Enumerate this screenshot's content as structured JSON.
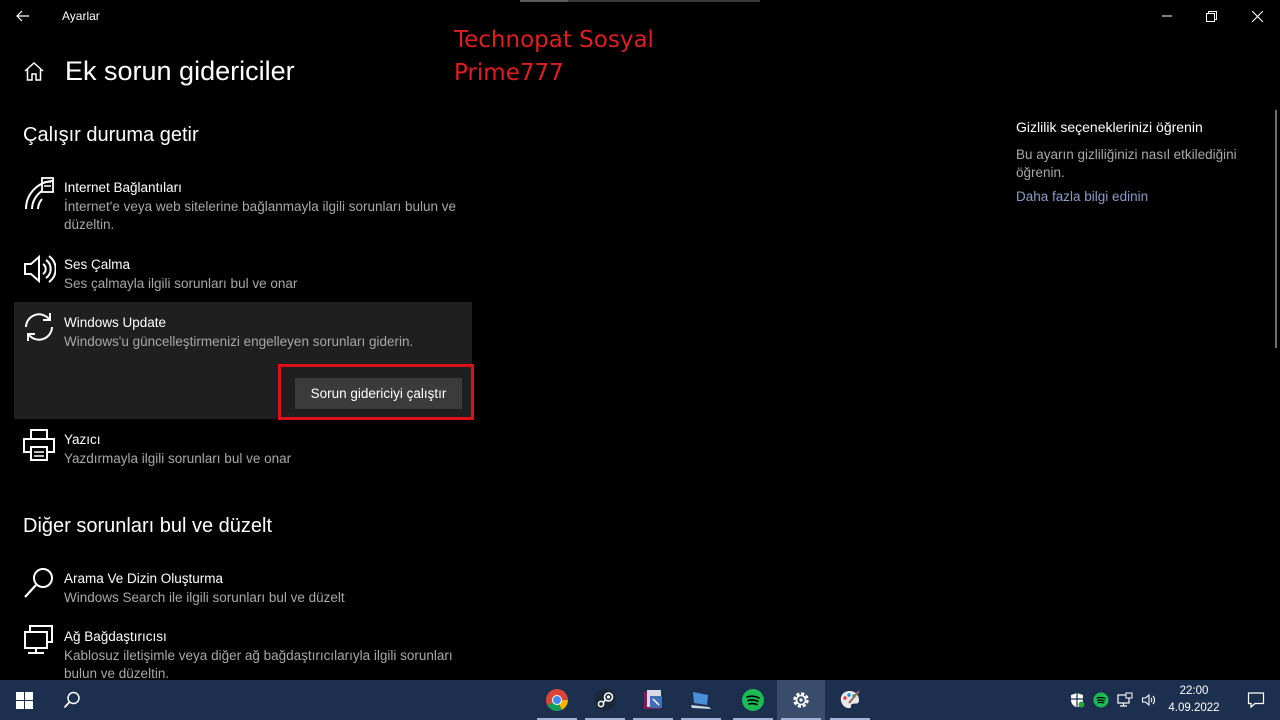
{
  "window": {
    "title": "Ayarlar",
    "back_icon": "arrow-left-icon",
    "controls": [
      "minimize-icon",
      "restore-icon",
      "close-icon"
    ]
  },
  "watermark": {
    "line1": "Technopat Sosyal",
    "line2": "Prime777",
    "color": "#e01e22"
  },
  "page": {
    "title": "Ek sorun gidericiler"
  },
  "sections": {
    "get_running": {
      "title": "Çalışır duruma getir",
      "items": [
        {
          "name": "Internet Bağlantıları",
          "description": "İnternet'e veya web sitelerine bağlanmayla ilgili sorunları bulun ve düzeltin.",
          "icon": "wifi-icon"
        },
        {
          "name": "Ses Çalma",
          "description": "Ses çalmayla ilgili sorunları bul ve onar",
          "icon": "speaker-icon"
        },
        {
          "name": "Windows Update",
          "description": "Windows'u güncelleştirmenizi engelleyen sorunları giderin.",
          "icon": "sync-icon",
          "button": "Sorun gidericiyi çalıştır"
        },
        {
          "name": "Yazıcı",
          "description": "Yazdırmayla ilgili sorunları bul ve onar",
          "icon": "printer-icon"
        }
      ]
    },
    "other": {
      "title": "Diğer sorunları bul ve düzelt",
      "items": [
        {
          "name": "Arama Ve Dizin Oluşturma",
          "description": "Windows Search ile ilgili sorunları bul ve düzelt",
          "icon": "search-icon"
        },
        {
          "name": "Ağ Bağdaştırıcısı",
          "description": "Kablosuz iletişimle veya diğer ağ bağdaştırıcılarıyla ilgili sorunları bulun ve düzeltin.",
          "icon": "network-adapter-icon"
        }
      ]
    }
  },
  "privacy": {
    "title": "Gizlilik seçeneklerinizi öğrenin",
    "text": "Bu ayarın gizliliğinizi nasıl etkilediğini öğrenin.",
    "link": "Daha fazla bilgi edinin"
  },
  "taskbar": {
    "apps": [
      "chrome-icon",
      "steam-icon",
      "file-archiver-icon",
      "laptop-app-icon",
      "spotify-icon",
      "settings-gear-icon",
      "paint-icon"
    ],
    "active_app": "settings-gear-icon",
    "tray": [
      "security-shield-icon",
      "spotify-tray-icon",
      "network-icon",
      "volume-icon"
    ],
    "time": "22:00",
    "date": "4.09.2022",
    "colors": {
      "background": "#1d2f4f",
      "active": "#3a4c6b"
    }
  },
  "colors": {
    "highlight_border": "#e0101a",
    "link": "#8a9bc4",
    "secondary_text": "#a8a8a8"
  }
}
